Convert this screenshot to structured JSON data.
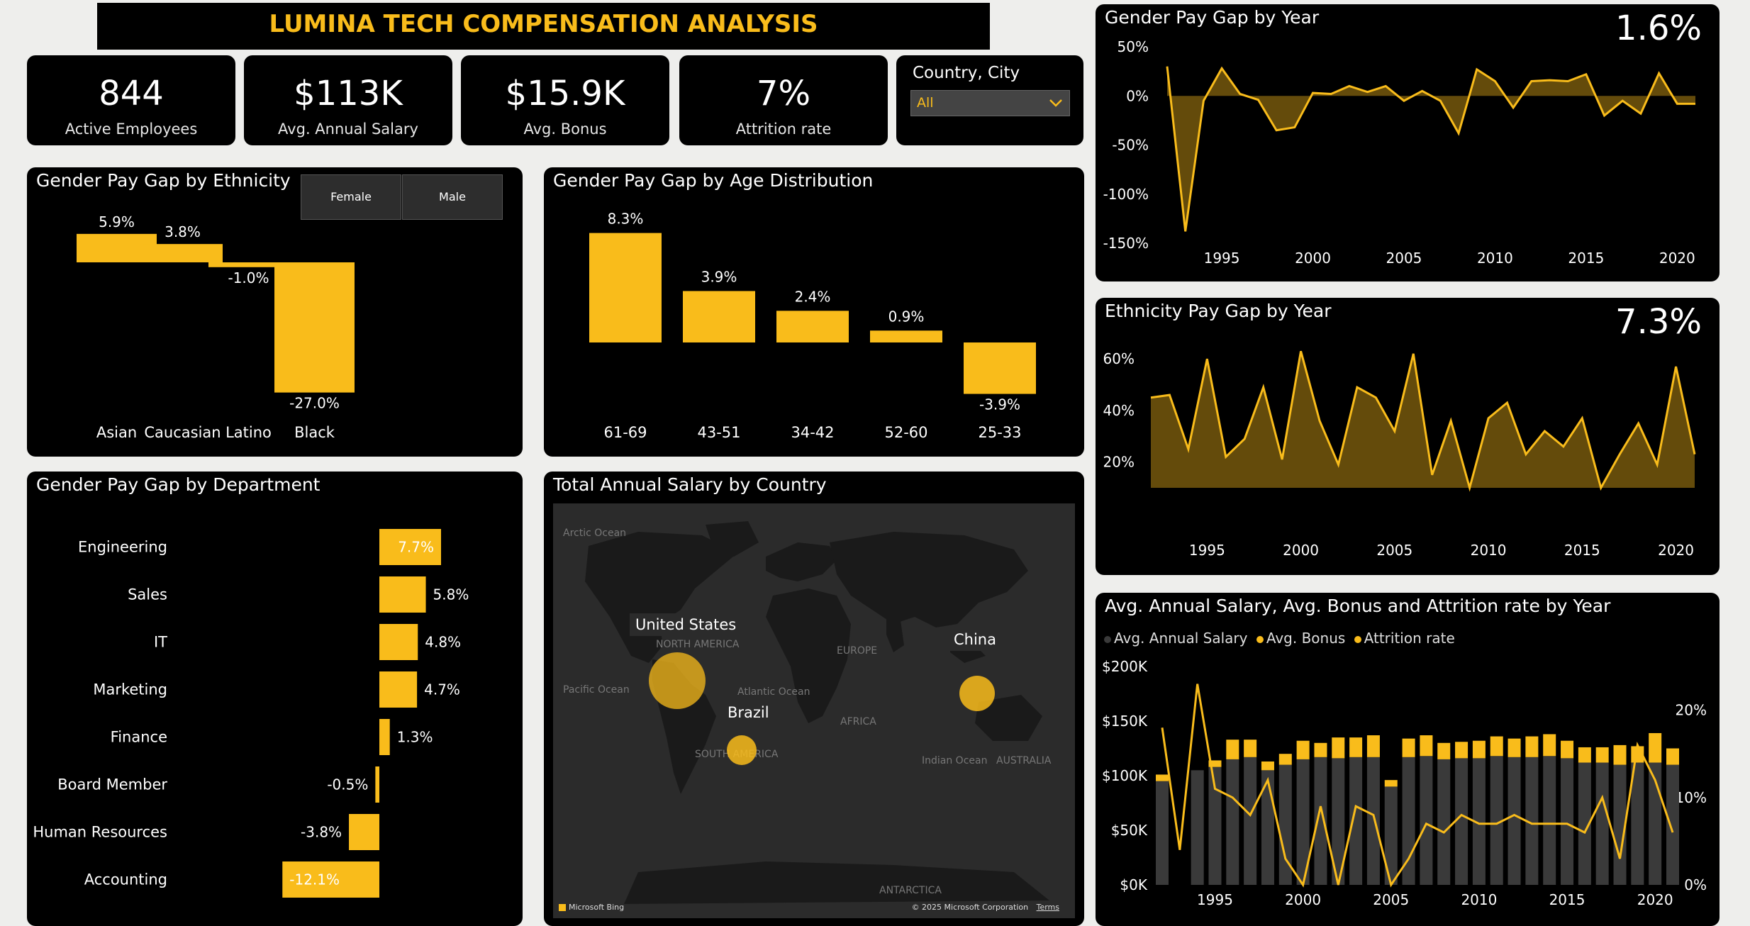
{
  "header": {
    "title": "LUMINA TECH COMPENSATION ANALYSIS"
  },
  "colors": {
    "accent": "#f9bc1b",
    "background": "#000000",
    "page": "#eeeeec",
    "bar_dark": "#3a3a3a",
    "map_bg": "#2b2b2b",
    "map_land": "#1b1b1b"
  },
  "kpis": [
    {
      "value": "844",
      "label": "Active Employees"
    },
    {
      "value": "$113K",
      "label": "Avg. Annual Salary"
    },
    {
      "value": "$15.9K",
      "label": "Avg. Bonus"
    },
    {
      "value": "7%",
      "label": "Attrition rate"
    }
  ],
  "filter": {
    "label": "Country, City",
    "value": "All",
    "icon": "chevron-down-icon"
  },
  "ethnicity_card": {
    "title": "Gender Pay Gap by Ethnicity",
    "buttons": [
      "Female",
      "Male"
    ]
  },
  "age_card": {
    "title": "Gender Pay Gap by Age Distribution"
  },
  "dept_card": {
    "title": "Gender Pay Gap by Department"
  },
  "map_card": {
    "title": "Total Annual Salary by Country",
    "region_labels": [
      "Arctic Ocean",
      "NORTH AMERICA",
      "Pacific Ocean",
      "Atlantic Ocean",
      "EUROPE",
      "AFRICA",
      "SOUTH AMERICA",
      "Indian Ocean",
      "AUSTRALIA",
      "ANTARCTICA"
    ],
    "bubbles": [
      "United States",
      "China",
      "Brazil"
    ],
    "bing_logo": "Microsoft Bing",
    "copyright": "© 2025 Microsoft Corporation",
    "terms": "Terms"
  },
  "gender_year_card": {
    "title": "Gender Pay Gap by Year",
    "kpi": "1.6%"
  },
  "ethnicity_year_card": {
    "title": "Ethnicity Pay Gap by Year",
    "kpi": "7.3%"
  },
  "combo_card": {
    "title": "Avg. Annual Salary, Avg. Bonus and Attrition rate by Year",
    "legend": [
      "Avg. Annual Salary",
      "Avg. Bonus",
      "Attrition rate"
    ]
  },
  "chart_data": [
    {
      "type": "bar",
      "title": "Gender Pay Gap by Ethnicity",
      "categories": [
        "Asian",
        "Caucasian",
        "Latino",
        "Black"
      ],
      "values": [
        5.9,
        3.8,
        -1.0,
        -27.0
      ],
      "data_labels": [
        "5.9%",
        "3.8%",
        "-1.0%",
        "-27.0%"
      ]
    },
    {
      "type": "bar",
      "title": "Gender Pay Gap by Age Distribution",
      "categories": [
        "61-69",
        "43-51",
        "34-42",
        "52-60",
        "25-33"
      ],
      "values": [
        8.3,
        3.9,
        2.4,
        0.9,
        -3.9
      ],
      "data_labels": [
        "8.3%",
        "3.9%",
        "2.4%",
        "0.9%",
        "-3.9%"
      ]
    },
    {
      "type": "bar",
      "orientation": "horizontal",
      "title": "Gender Pay Gap by Department",
      "categories": [
        "Engineering",
        "Sales",
        "IT",
        "Marketing",
        "Finance",
        "Board Member",
        "Human Resources",
        "Accounting"
      ],
      "values": [
        7.7,
        5.8,
        4.8,
        4.7,
        1.3,
        -0.5,
        -3.8,
        -12.1
      ],
      "data_labels": [
        "7.7%",
        "5.8%",
        "4.8%",
        "4.7%",
        "1.3%",
        "-0.5%",
        "-3.8%",
        "-12.1%"
      ]
    },
    {
      "type": "area",
      "title": "Gender Pay Gap by Year",
      "x": [
        1992,
        1993,
        1994,
        1995,
        1996,
        1997,
        1998,
        1999,
        2000,
        2001,
        2002,
        2003,
        2004,
        2005,
        2006,
        2007,
        2008,
        2009,
        2010,
        2011,
        2012,
        2013,
        2014,
        2015,
        2016,
        2017,
        2018,
        2019,
        2020,
        2021
      ],
      "y": [
        30,
        -138,
        -5,
        28,
        2,
        -4,
        -35,
        -32,
        3,
        2,
        10,
        4,
        10,
        -5,
        5,
        -5,
        -38,
        27,
        15,
        -12,
        15,
        16,
        15,
        22,
        -20,
        -5,
        -18,
        23,
        -8,
        -8
      ],
      "ylim": [
        -150,
        50
      ],
      "yticks": [
        "50%",
        "0%",
        "-50%",
        "-100%",
        "-150%"
      ],
      "xticks": [
        "1995",
        "2000",
        "2005",
        "2010",
        "2015",
        "2020"
      ]
    },
    {
      "type": "area",
      "title": "Ethnicity Pay Gap by Year",
      "x": [
        1992,
        1993,
        1994,
        1995,
        1996,
        1997,
        1998,
        1999,
        2000,
        2001,
        2002,
        2003,
        2004,
        2005,
        2006,
        2007,
        2008,
        2009,
        2010,
        2011,
        2012,
        2013,
        2014,
        2015,
        2016,
        2017,
        2018,
        2019,
        2020,
        2021
      ],
      "y": [
        45,
        46,
        25,
        60,
        22,
        29,
        49,
        21,
        63,
        36,
        19,
        49,
        45,
        32,
        62,
        15,
        36,
        10,
        37,
        43,
        23,
        32,
        26,
        37,
        10,
        23,
        35,
        19,
        57,
        23
      ],
      "ylim": [
        10,
        65
      ],
      "yticks": [
        "60%",
        "40%",
        "20%"
      ],
      "xticks": [
        "1995",
        "2000",
        "2005",
        "2010",
        "2015",
        "2020"
      ]
    },
    {
      "type": "bar",
      "title": "Avg. Annual Salary, Avg. Bonus and Attrition rate by Year",
      "x": [
        1992,
        1993,
        1994,
        1995,
        1996,
        1997,
        1998,
        1999,
        2000,
        2001,
        2002,
        2003,
        2004,
        2005,
        2006,
        2007,
        2008,
        2009,
        2010,
        2011,
        2012,
        2013,
        2014,
        2015,
        2016,
        2017,
        2018,
        2019,
        2020,
        2021
      ],
      "series": [
        {
          "name": "Avg. Annual Salary",
          "type": "bar",
          "values": [
            95,
            0,
            105,
            108,
            115,
            117,
            105,
            110,
            115,
            117,
            116,
            117,
            117,
            90,
            117,
            118,
            115,
            116,
            116,
            118,
            117,
            117,
            118,
            116,
            112,
            112,
            110,
            112,
            112,
            110
          ]
        },
        {
          "name": "Avg. Bonus",
          "type": "bar",
          "values": [
            6,
            0,
            0,
            6,
            18,
            16,
            8,
            10,
            17,
            13,
            19,
            18,
            20,
            6,
            17,
            19,
            15,
            15,
            16,
            18,
            17,
            19,
            20,
            16,
            14,
            14,
            18,
            15,
            27,
            15
          ]
        },
        {
          "name": "Attrition rate",
          "type": "line",
          "axis": "right",
          "values": [
            18,
            4,
            23,
            11,
            10,
            8,
            12,
            3,
            0,
            9,
            0,
            9,
            8,
            0,
            3,
            7,
            6,
            8,
            7,
            7,
            8,
            7,
            7,
            7,
            6,
            10,
            3,
            16,
            12,
            6
          ]
        }
      ],
      "ylim": [
        0,
        200
      ],
      "y2lim": [
        0,
        25
      ],
      "yticks": [
        "$200K",
        "$150K",
        "$100K",
        "$50K",
        "$0K"
      ],
      "y2ticks": [
        "20%",
        "10%",
        "0%"
      ],
      "xticks": [
        "1995",
        "2000",
        "2005",
        "2010",
        "2015",
        "2020"
      ]
    }
  ]
}
